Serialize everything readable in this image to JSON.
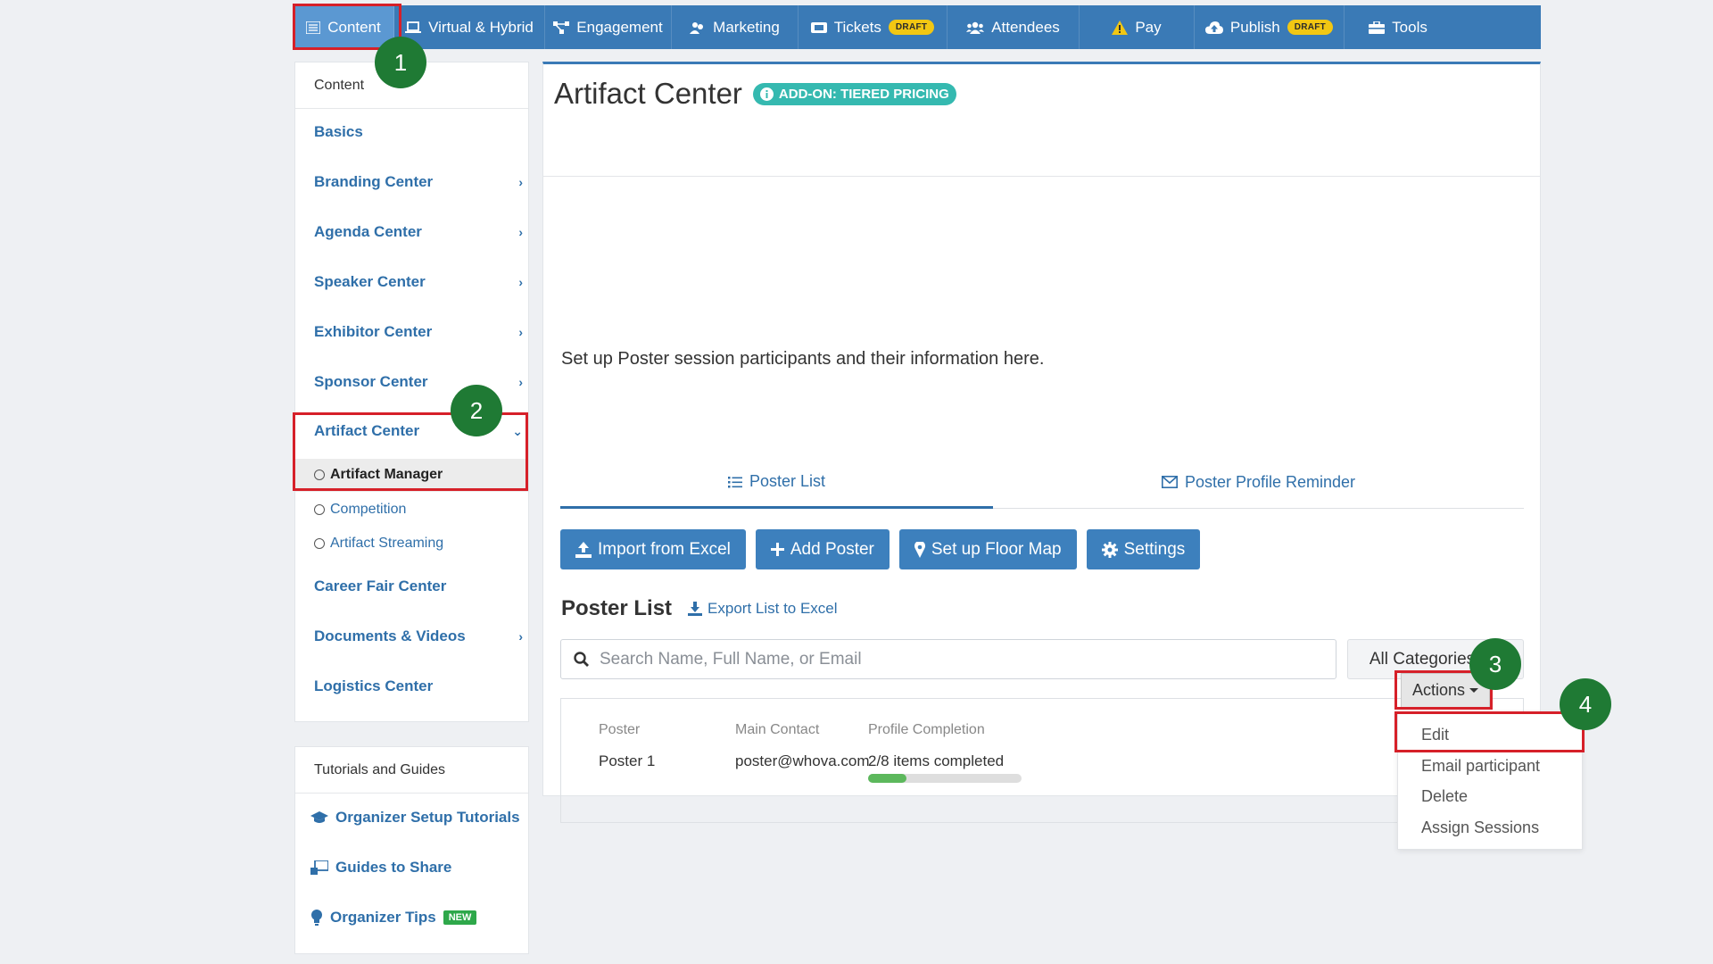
{
  "topnav": {
    "items": [
      {
        "label": "Content",
        "icon": "list-icon"
      },
      {
        "label": "Virtual & Hybrid",
        "icon": "laptop-icon"
      },
      {
        "label": "Engagement",
        "icon": "network-icon"
      },
      {
        "label": "Marketing",
        "icon": "people-icon"
      },
      {
        "label": "Tickets",
        "icon": "ticket-icon",
        "badge": "DRAFT"
      },
      {
        "label": "Attendees",
        "icon": "users-icon"
      },
      {
        "label": "Pay",
        "icon": "warning-icon"
      },
      {
        "label": "Publish",
        "icon": "cloud-upload-icon",
        "badge": "DRAFT"
      },
      {
        "label": "Tools",
        "icon": "toolbox-icon"
      }
    ]
  },
  "markers": [
    "1",
    "2",
    "3",
    "4"
  ],
  "sidebar": {
    "header": "Content",
    "items": [
      {
        "label": "Basics"
      },
      {
        "label": "Branding Center"
      },
      {
        "label": "Agenda Center"
      },
      {
        "label": "Speaker Center"
      },
      {
        "label": "Exhibitor Center"
      },
      {
        "label": "Sponsor Center"
      },
      {
        "label": "Artifact Center"
      },
      {
        "label": "Career Fair Center"
      },
      {
        "label": "Documents & Videos"
      },
      {
        "label": "Logistics Center"
      }
    ],
    "subitems": [
      {
        "label": "Artifact Manager"
      },
      {
        "label": "Competition"
      },
      {
        "label": "Artifact Streaming"
      }
    ]
  },
  "tutorials": {
    "header": "Tutorials and Guides",
    "items": [
      {
        "label": "Organizer Setup Tutorials",
        "icon": "graduation-cap-icon"
      },
      {
        "label": "Guides to Share",
        "icon": "share-guide-icon"
      },
      {
        "label": "Organizer Tips",
        "icon": "lightbulb-icon",
        "badge": "NEW"
      }
    ]
  },
  "main": {
    "title": "Artifact Center",
    "addon_badge": "ADD-ON: TIERED PRICING",
    "description": "Set up Poster session participants and their information here.",
    "tabs": [
      {
        "label": "Poster List",
        "icon": "list-icon"
      },
      {
        "label": "Poster Profile Reminder",
        "icon": "envelope-icon"
      }
    ],
    "buttons": [
      {
        "label": "Import from Excel",
        "icon": "upload-icon"
      },
      {
        "label": "Add Poster",
        "icon": "plus-icon"
      },
      {
        "label": "Set up Floor Map",
        "icon": "map-pin-icon"
      },
      {
        "label": "Settings",
        "icon": "gear-icon"
      }
    ],
    "list_title": "Poster List",
    "export_label": "Export List to Excel",
    "search_placeholder": "Search Name, Full Name, or Email",
    "category_select": "All Categories",
    "table": {
      "headers": [
        "Poster",
        "Main Contact",
        "Profile Completion"
      ],
      "rows": [
        {
          "poster": "Poster 1",
          "contact": "poster@whova.com",
          "completion": "2/8 items completed",
          "progress": 0.25
        }
      ]
    },
    "actions_label": "Actions",
    "dropdown": [
      "Edit",
      "Email participant",
      "Delete",
      "Assign Sessions"
    ]
  },
  "colors": {
    "nav_bg": "#3a7ab6",
    "nav_active": "#5b98d2",
    "link": "#2f6fa9",
    "button": "#3d80bd",
    "highlight": "#d62029",
    "marker": "#1f7a34",
    "draft_badge": "#f2c713",
    "addon_badge": "#35b9b0",
    "progress": "#5cb85c"
  }
}
